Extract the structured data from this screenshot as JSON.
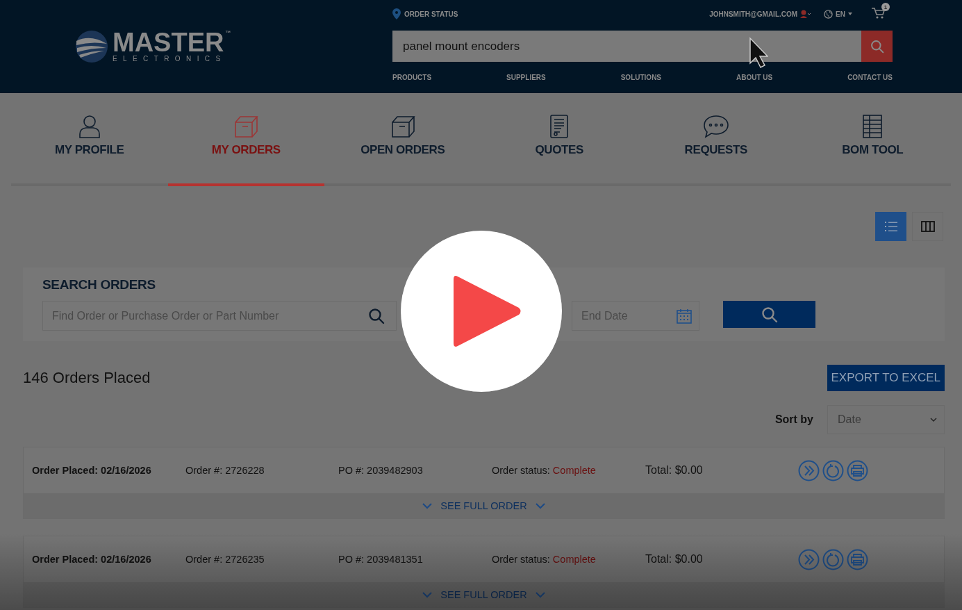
{
  "header": {
    "order_status": "ORDER STATUS",
    "account_email": "JOHNSMITH@GMAIL.COM",
    "language": "EN",
    "cart_count": "1",
    "search": {
      "value": "panel mount encoders"
    },
    "nav": [
      "PRODUCTS",
      "SUPPLIERS",
      "SOLUTIONS",
      "ABOUT US",
      "CONTACT US"
    ]
  },
  "logo": {
    "name": "MASTER",
    "trademark": "™",
    "tagline": "ELECTRONICS"
  },
  "tabs": [
    {
      "label": "MY PROFILE",
      "kind": "person",
      "selected": false
    },
    {
      "label": "MY ORDERS",
      "kind": "box",
      "selected": true
    },
    {
      "label": "OPEN ORDERS",
      "kind": "box",
      "selected": false
    },
    {
      "label": "QUOTES",
      "kind": "document",
      "selected": false
    },
    {
      "label": "REQUESTS",
      "kind": "speech",
      "selected": false
    },
    {
      "label": "BOM TOOL",
      "kind": "grid",
      "selected": false
    }
  ],
  "view_toggle": [
    {
      "kind": "list",
      "selected": true
    },
    {
      "kind": "columns",
      "selected": false
    }
  ],
  "search_orders": {
    "title": "SEARCH ORDERS",
    "query_placeholder": "Find Order or Purchase Order or Part Number",
    "end_date_placeholder": "End Date"
  },
  "orders_count": "146 Orders Placed",
  "export_button": "EXPORT TO EXCEL",
  "sort": {
    "label": "Sort by",
    "value": "Date"
  },
  "orders": [
    {
      "placed": "Order Placed: 02/16/2026",
      "order_number": "Order #: 2726228",
      "po": "PO #: 2039482903",
      "status_label": "Order status:",
      "status": "Complete",
      "total": "Total: $0.00",
      "see_full": "SEE FULL ORDER"
    },
    {
      "placed": "Order Placed: 02/16/2026",
      "order_number": "Order #: 2726235",
      "po": "PO #: 2039481351",
      "status_label": "Order status:",
      "status": "Complete",
      "total": "Total: $0.00",
      "see_full": "SEE FULL ORDER"
    }
  ],
  "video_overlay": {
    "paused": true
  }
}
